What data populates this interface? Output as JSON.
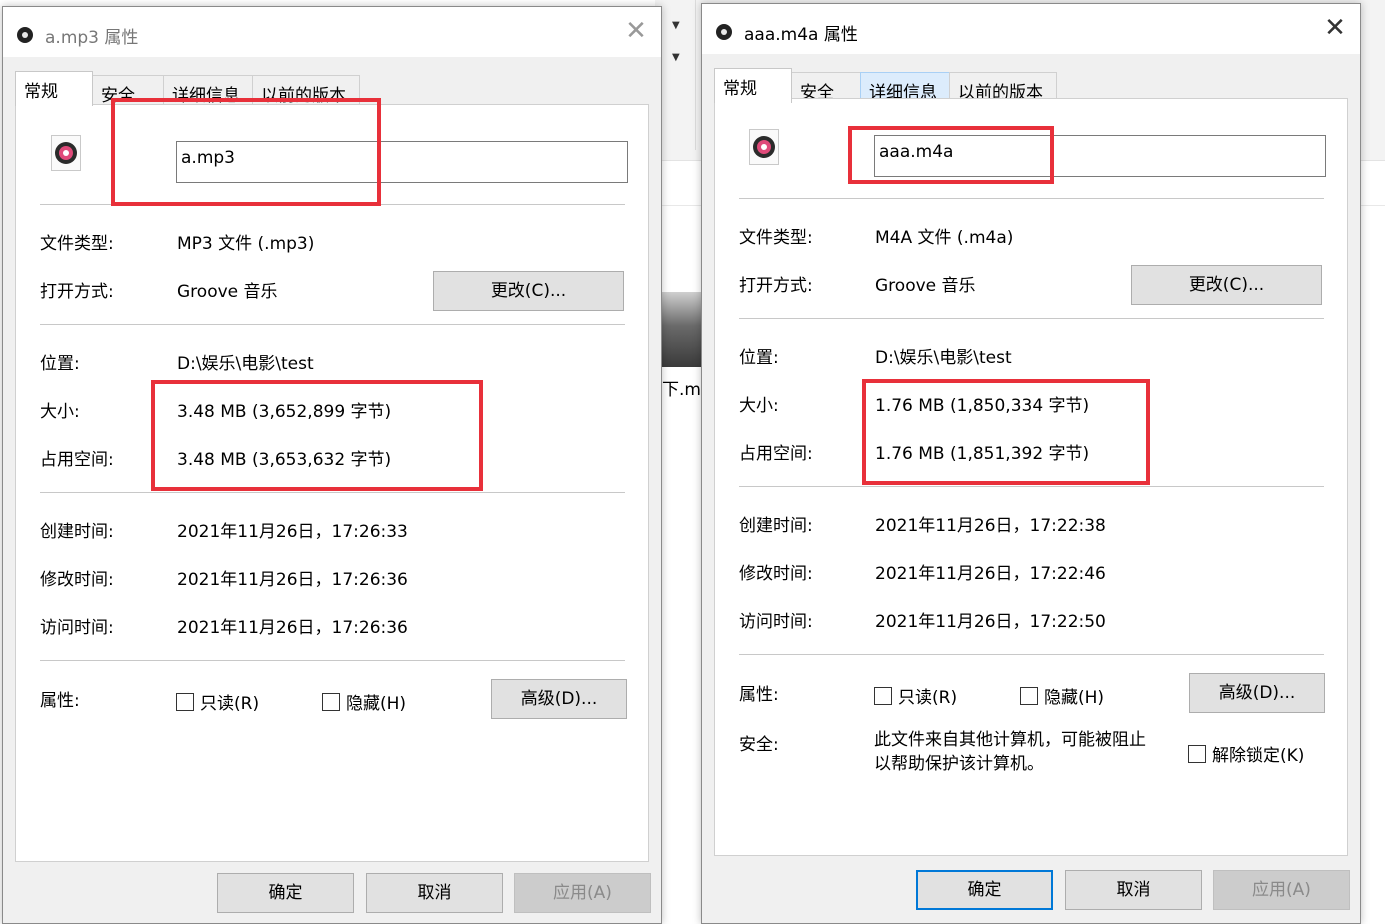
{
  "dialog_left": {
    "title": "a.mp3 属性",
    "tabs": [
      "常规",
      "安全",
      "详细信息",
      "以前的版本"
    ],
    "file_name": "a.mp3",
    "labels": {
      "type": "文件类型:",
      "open_with": "打开方式:",
      "location": "位置:",
      "size": "大小:",
      "size_on_disk": "占用空间:",
      "created": "创建时间:",
      "modified": "修改时间:",
      "accessed": "访问时间:",
      "attributes": "属性:"
    },
    "values": {
      "type": "MP3 文件 (.mp3)",
      "open_with": "Groove 音乐",
      "location": "D:\\娱乐\\电影\\test",
      "size": "3.48 MB (3,652,899 字节)",
      "size_on_disk": "3.48 MB (3,653,632 字节)",
      "created": "2021年11月26日，17:26:33",
      "modified": "2021年11月26日，17:26:36",
      "accessed": "2021年11月26日，17:26:36"
    },
    "change_button": "更改(C)...",
    "readonly": "只读(R)",
    "hidden": "隐藏(H)",
    "advanced_button": "高级(D)...",
    "ok": "确定",
    "cancel": "取消",
    "apply": "应用(A)"
  },
  "dialog_right": {
    "title": "aaa.m4a 属性",
    "tabs": [
      "常规",
      "安全",
      "详细信息",
      "以前的版本"
    ],
    "file_name": "aaa.m4a",
    "labels": {
      "type": "文件类型:",
      "open_with": "打开方式:",
      "location": "位置:",
      "size": "大小:",
      "size_on_disk": "占用空间:",
      "created": "创建时间:",
      "modified": "修改时间:",
      "accessed": "访问时间:",
      "attributes": "属性:",
      "security": "安全:"
    },
    "values": {
      "type": "M4A 文件 (.m4a)",
      "open_with": "Groove 音乐",
      "location": "D:\\娱乐\\电影\\test",
      "size": "1.76 MB (1,850,334 字节)",
      "size_on_disk": "1.76 MB (1,851,392 字节)",
      "created": "2021年11月26日，17:22:38",
      "modified": "2021年11月26日，17:22:46",
      "accessed": "2021年11月26日，17:22:50"
    },
    "change_button": "更改(C)...",
    "readonly": "只读(R)",
    "hidden": "隐藏(H)",
    "advanced_button": "高级(D)...",
    "security_line1": "此文件来自其他计算机，可能被阻止",
    "security_line2": "以帮助保护该计算机。",
    "unblock": "解除锁定(K)",
    "ok": "确定",
    "cancel": "取消",
    "apply": "应用(A)"
  },
  "background": {
    "thumbnail_label": "下.m"
  },
  "colors": {
    "highlight_box": "#e8303a",
    "default_button_border": "#0078d7",
    "dialog_bg": "#f0f0f0"
  }
}
